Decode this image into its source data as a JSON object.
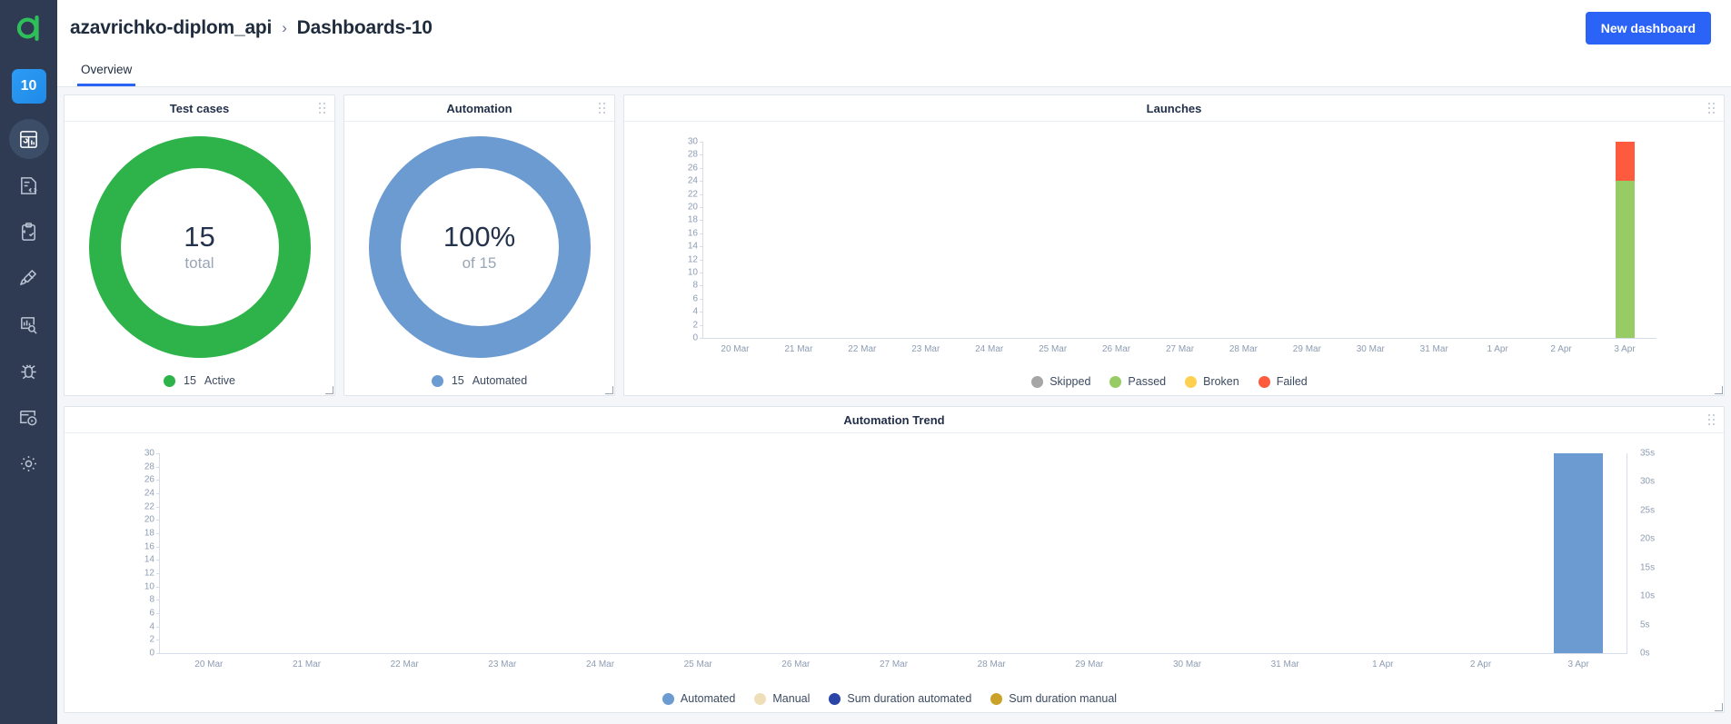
{
  "sidebar": {
    "badge": "10",
    "items": [
      {
        "name": "dashboards-icon",
        "label": "Dashboards",
        "active": true
      },
      {
        "name": "test-cases-icon",
        "label": "Test cases",
        "active": false
      },
      {
        "name": "test-plans-icon",
        "label": "Test plans",
        "active": false
      },
      {
        "name": "launches-icon",
        "label": "Launches",
        "active": false
      },
      {
        "name": "reports-icon",
        "label": "Reports",
        "active": false
      },
      {
        "name": "defects-icon",
        "label": "Defects",
        "active": false
      },
      {
        "name": "history-icon",
        "label": "History",
        "active": false
      },
      {
        "name": "settings-icon",
        "label": "Settings",
        "active": false
      }
    ]
  },
  "header": {
    "project": "azavrichko-diplom_api",
    "separator": "›",
    "dashboard": "Dashboards-10",
    "new_dashboard_label": "New dashboard",
    "accent_color": "#2a63f5"
  },
  "tabs": [
    {
      "label": "Overview",
      "active": true
    }
  ],
  "panels": {
    "test_cases": {
      "title": "Test cases",
      "value": "15",
      "sub": "total",
      "color": "#2eb34a",
      "legend": [
        {
          "count": "15",
          "label": "Active",
          "color": "#2eb34a"
        }
      ]
    },
    "automation": {
      "title": "Automation",
      "value": "100%",
      "sub": "of 15",
      "color": "#6c9bd2",
      "legend": [
        {
          "count": "15",
          "label": "Automated",
          "color": "#6c9bd2"
        }
      ]
    },
    "launches": {
      "title": "Launches"
    },
    "automation_trend": {
      "title": "Automation Trend"
    }
  },
  "chart_data": [
    {
      "type": "bar",
      "title": "Launches",
      "stacked": true,
      "xlabel": "",
      "ylabel": "",
      "ylim": [
        0,
        30
      ],
      "ytick_step": 2,
      "yticks": [
        0,
        2,
        4,
        6,
        8,
        10,
        12,
        14,
        16,
        18,
        20,
        22,
        24,
        26,
        28,
        30
      ],
      "grid": false,
      "legend_position": "bottom",
      "categories": [
        "20 Mar",
        "21 Mar",
        "22 Mar",
        "23 Mar",
        "24 Mar",
        "25 Mar",
        "26 Mar",
        "27 Mar",
        "28 Mar",
        "29 Mar",
        "30 Mar",
        "31 Mar",
        "1 Apr",
        "2 Apr",
        "3 Apr"
      ],
      "series": [
        {
          "name": "Skipped",
          "color": "#a6a6a6",
          "values": [
            0,
            0,
            0,
            0,
            0,
            0,
            0,
            0,
            0,
            0,
            0,
            0,
            0,
            0,
            0
          ]
        },
        {
          "name": "Passed",
          "color": "#97cc64",
          "values": [
            0,
            0,
            0,
            0,
            0,
            0,
            0,
            0,
            0,
            0,
            0,
            0,
            0,
            0,
            24
          ]
        },
        {
          "name": "Broken",
          "color": "#ffd050",
          "values": [
            0,
            0,
            0,
            0,
            0,
            0,
            0,
            0,
            0,
            0,
            0,
            0,
            0,
            0,
            0
          ]
        },
        {
          "name": "Failed",
          "color": "#fd5a3e",
          "values": [
            0,
            0,
            0,
            0,
            0,
            0,
            0,
            0,
            0,
            0,
            0,
            0,
            0,
            0,
            6
          ]
        }
      ]
    },
    {
      "type": "bar",
      "title": "Automation Trend",
      "stacked": true,
      "xlabel": "",
      "ylabel": "",
      "ylim": [
        0,
        30
      ],
      "ytick_step": 2,
      "yticks": [
        0,
        2,
        4,
        6,
        8,
        10,
        12,
        14,
        16,
        18,
        20,
        22,
        24,
        26,
        28,
        30
      ],
      "y2lim": [
        0,
        35
      ],
      "y2ticks": [
        "0s",
        "5s",
        "10s",
        "15s",
        "20s",
        "25s",
        "30s",
        "35s"
      ],
      "grid": false,
      "legend_position": "bottom",
      "categories": [
        "20 Mar",
        "21 Mar",
        "22 Mar",
        "23 Mar",
        "24 Mar",
        "25 Mar",
        "26 Mar",
        "27 Mar",
        "28 Mar",
        "29 Mar",
        "30 Mar",
        "31 Mar",
        "1 Apr",
        "2 Apr",
        "3 Apr"
      ],
      "series": [
        {
          "name": "Automated",
          "color": "#6c9bd2",
          "values": [
            0,
            0,
            0,
            0,
            0,
            0,
            0,
            0,
            0,
            0,
            0,
            0,
            0,
            0,
            30
          ]
        },
        {
          "name": "Manual",
          "color": "#efdfb8",
          "values": [
            0,
            0,
            0,
            0,
            0,
            0,
            0,
            0,
            0,
            0,
            0,
            0,
            0,
            0,
            0
          ]
        },
        {
          "name": "Sum duration automated",
          "color": "#2b44a8",
          "axis": "right",
          "values": [
            0,
            0,
            0,
            0,
            0,
            0,
            0,
            0,
            0,
            0,
            0,
            0,
            0,
            0,
            0
          ]
        },
        {
          "name": "Sum duration manual",
          "color": "#c9a227",
          "axis": "right",
          "values": [
            0,
            0,
            0,
            0,
            0,
            0,
            0,
            0,
            0,
            0,
            0,
            0,
            0,
            0,
            0
          ]
        }
      ]
    }
  ]
}
